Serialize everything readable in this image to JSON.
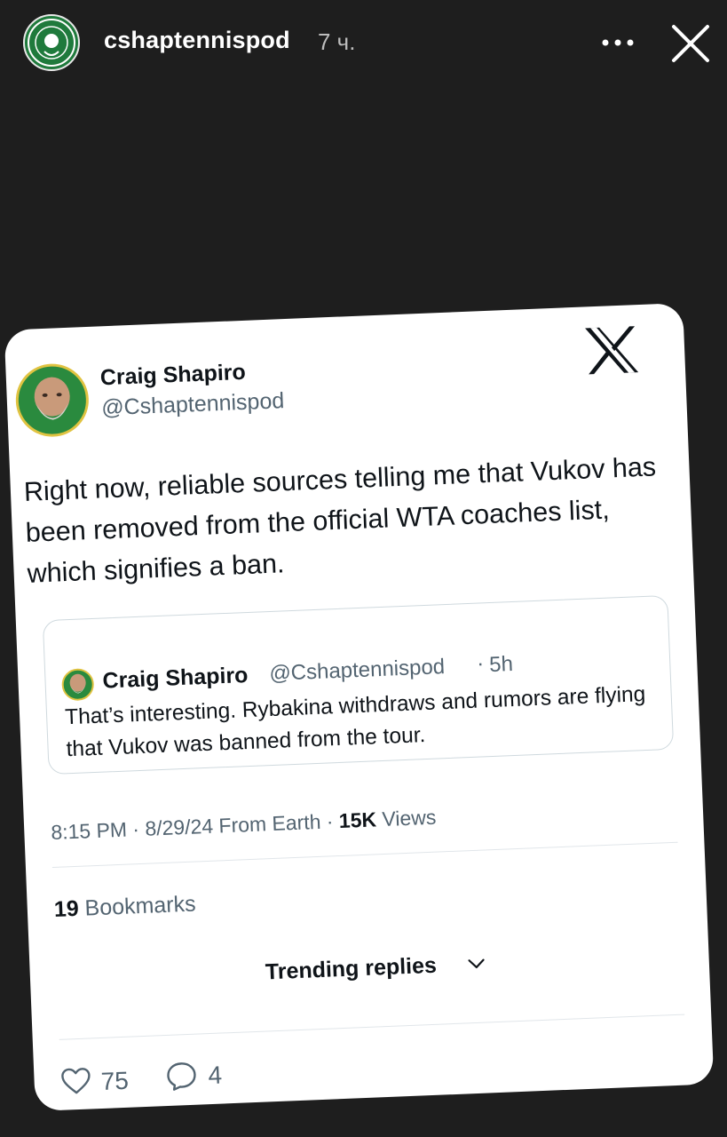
{
  "story": {
    "username": "cshaptennispod",
    "time": "7 ч.",
    "icons": {
      "avatar": "tennis-club-logo",
      "more": "more-horizontal-icon",
      "close": "close-icon"
    }
  },
  "tweet": {
    "author_name": "Craig Shapiro",
    "author_handle": "@Cshaptennispod",
    "platform_logo": "x-logo",
    "text": "Right now, reliable sources telling me that Vukov has been removed from the official WTA coaches list, which signifies a ban.",
    "quote": {
      "author_name": "Craig Shapiro",
      "author_handle": "@Cshaptennispod",
      "separator": "·",
      "age": "5h",
      "text": "That’s interesting. Rybakina withdraws and rumors are flying that Vukov was banned from the tour."
    },
    "meta": {
      "time": "8:15 PM",
      "sep1": " · ",
      "date": "8/29/24",
      "source": " From Earth",
      "sep2": " · ",
      "views_count": "15K",
      "views_label": " Views"
    },
    "bookmarks": {
      "count": "19",
      "label": " Bookmarks"
    },
    "trending_label": "Trending replies",
    "actions": {
      "likes": "75",
      "replies": "4"
    }
  },
  "colors": {
    "background": "#1e1e1e",
    "card": "#ffffff",
    "secondary_text": "#536471",
    "primary_text": "#0f1419",
    "avatar_green": "#1f7a3c"
  }
}
